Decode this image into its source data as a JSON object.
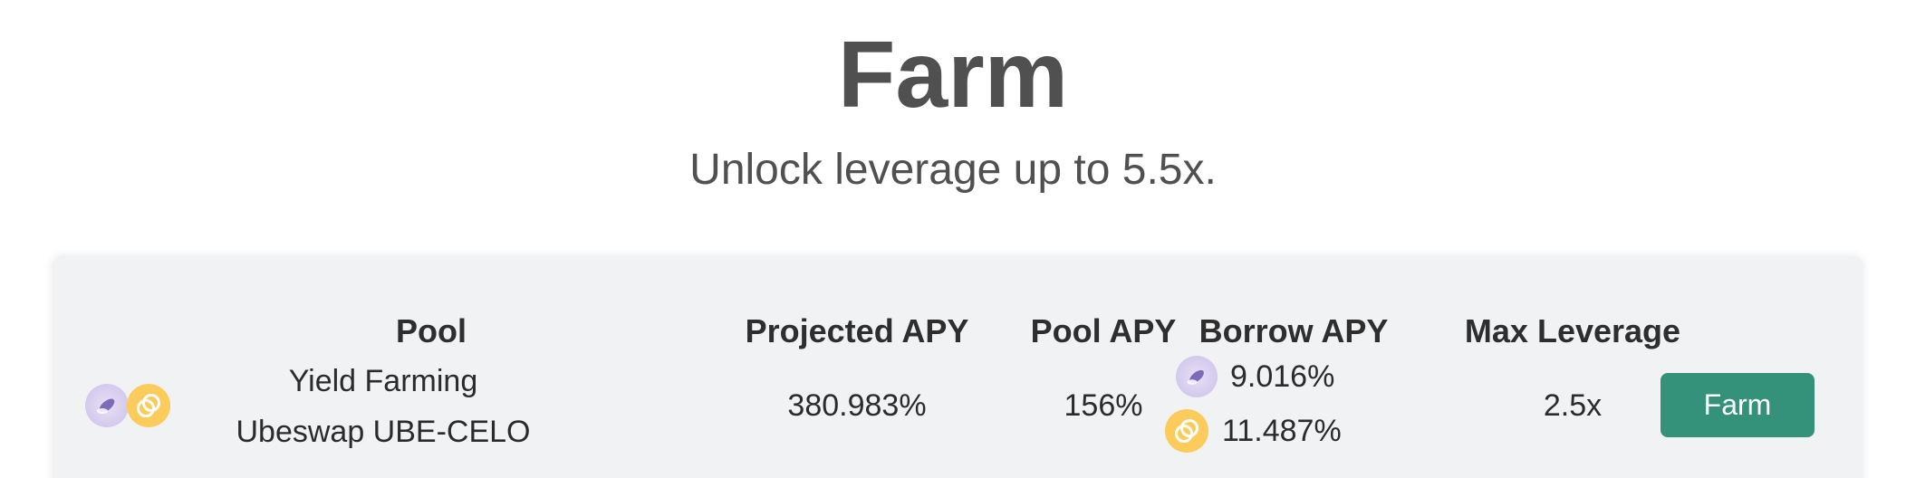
{
  "header": {
    "title": "Farm",
    "subtitle": "Unlock leverage up to 5.5x."
  },
  "table": {
    "columns": {
      "pool": "Pool",
      "projected_apy": "Projected APY",
      "pool_apy": "Pool APY",
      "borrow_apy": "Borrow APY",
      "max_leverage": "Max Leverage"
    },
    "rows": [
      {
        "pool_line1": "Yield Farming",
        "pool_line2": "Ubeswap UBE-CELO",
        "tokens": [
          "ube-token-icon",
          "celo-token-icon"
        ],
        "projected_apy": "380.983%",
        "pool_apy": "156%",
        "borrow_apy": [
          {
            "token": "ube-token-icon",
            "value": "9.016%"
          },
          {
            "token": "celo-token-icon",
            "value": "11.487%"
          }
        ],
        "max_leverage": "2.5x",
        "action_label": "Farm"
      }
    ]
  },
  "colors": {
    "button": "#35927a",
    "card_background": "#f0f2f3",
    "celo": "#fbcc5c",
    "ube": "#d6ccee"
  }
}
